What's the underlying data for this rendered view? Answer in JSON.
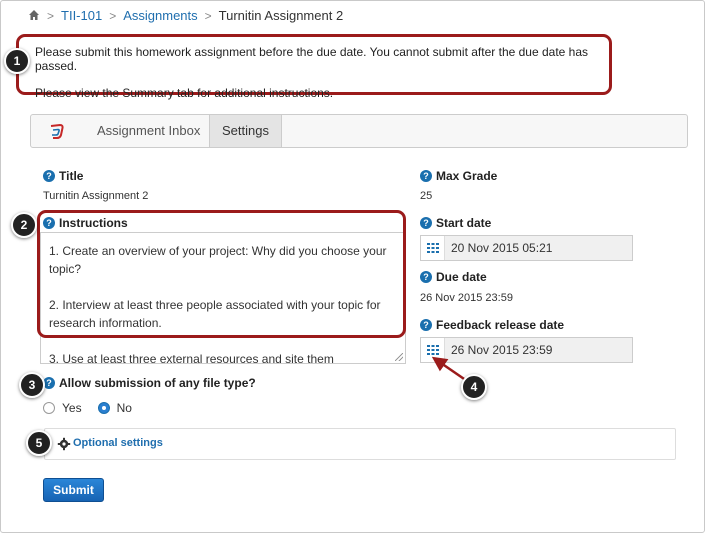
{
  "breadcrumb": {
    "home_icon": "home-icon",
    "items": [
      "TII-101",
      "Assignments"
    ],
    "current": "Turnitin Assignment 2"
  },
  "alert": {
    "line1": "Please submit this homework assignment before the due date. You cannot submit after the due date has passed.",
    "line2": "Please view the Summary tab for additional instructions."
  },
  "callouts": [
    "1",
    "2",
    "3",
    "4",
    "5"
  ],
  "tabs": {
    "logo_icon": "turnitin-logo-icon",
    "items": [
      {
        "label": "Assignment Inbox",
        "active": false
      },
      {
        "label": "Settings",
        "active": true
      }
    ]
  },
  "form": {
    "title_label": "Title",
    "title_value": "Turnitin Assignment 2",
    "instructions_label": "Instructions",
    "instructions": [
      "1. Create an overview of your project: Why did you choose your topic?",
      "2. Interview at least three people associated with your topic for research information.",
      "3. Use at least three external resources and site them"
    ],
    "allow_label": "Allow submission of any file type?",
    "options": [
      "Yes",
      "No"
    ],
    "selected_option": "No",
    "optional_settings": "Optional settings",
    "submit_label": "Submit",
    "max_grade_label": "Max Grade",
    "max_grade_value": "25",
    "start_date_label": "Start date",
    "start_date_value": "20 Nov 2015 05:21",
    "due_date_label": "Due date",
    "due_date_value": "26 Nov 2015 23:59",
    "feedback_label": "Feedback release date",
    "feedback_value": "26 Nov 2015 23:59"
  },
  "colors": {
    "link": "#1f6eae",
    "highlight": "#9b1b1b",
    "button": "#1a6fc4",
    "help": "#1a6fae"
  }
}
